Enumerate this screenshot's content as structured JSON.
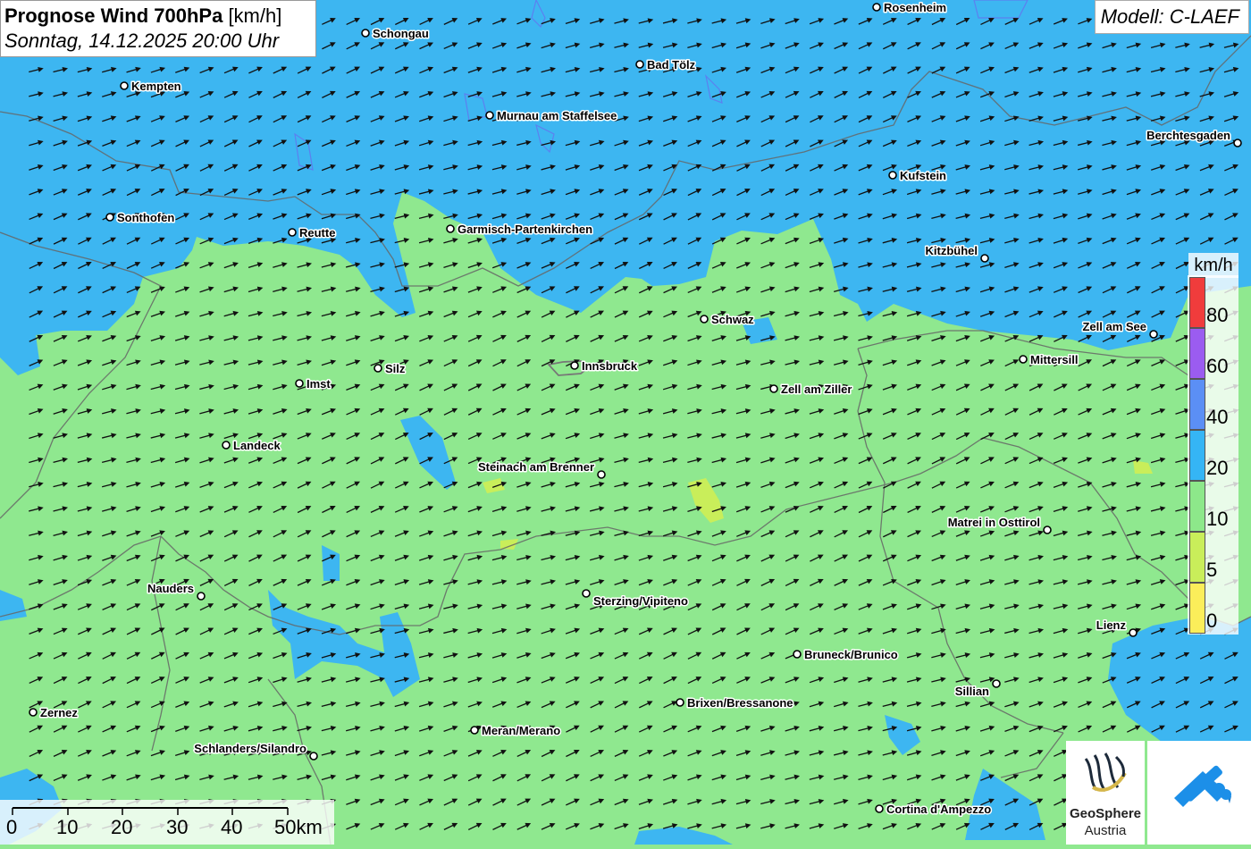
{
  "header": {
    "title_bold": "Prognose Wind 700hPa",
    "title_unit": "[km/h]",
    "subtitle": "Sonntag, 14.12.2025 20:00 Uhr"
  },
  "model": "Modell: C-LAEF",
  "legend": {
    "unit": "km/h",
    "ticks": [
      "80",
      "60",
      "40",
      "20",
      "10",
      "5",
      "0"
    ],
    "colors": [
      "#f03c3c",
      "#9b5cf0",
      "#5b8ff5",
      "#35b5f5",
      "#8de88a",
      "#c9ee5a",
      "#fbee5a"
    ]
  },
  "scale": {
    "labels": [
      "0",
      "10",
      "20",
      "30",
      "40",
      "50km"
    ]
  },
  "colors": {
    "land_green": "#8fe88f",
    "water_blue": "#3db6f1",
    "arrow": "#111111"
  },
  "cities": [
    {
      "name": "Rosenheim"
    },
    {
      "name": "Schongau"
    },
    {
      "name": "Bad Tölz"
    },
    {
      "name": "Kempten"
    },
    {
      "name": "Murnau am Staffelsee"
    },
    {
      "name": "Berchtesgaden"
    },
    {
      "name": "Kufstein"
    },
    {
      "name": "Sonthofen"
    },
    {
      "name": "Reutte"
    },
    {
      "name": "Garmisch-Partenkirchen"
    },
    {
      "name": "Kitzbühel"
    },
    {
      "name": "Schwaz"
    },
    {
      "name": "Zell am See"
    },
    {
      "name": "Mittersill"
    },
    {
      "name": "Silz"
    },
    {
      "name": "Innsbruck"
    },
    {
      "name": "Imst"
    },
    {
      "name": "Zell am Ziller"
    },
    {
      "name": "Landeck"
    },
    {
      "name": "Steinach am Brenner"
    },
    {
      "name": "Matrei in Osttirol"
    },
    {
      "name": "Nauders"
    },
    {
      "name": "Sterzing/Vipiteno"
    },
    {
      "name": "Lienz"
    },
    {
      "name": "Bruneck/Brunico"
    },
    {
      "name": "Sillian"
    },
    {
      "name": "Brixen/Bressanone"
    },
    {
      "name": "Zernez"
    },
    {
      "name": "Meran/Merano"
    },
    {
      "name": "Schlanders/Silandro"
    },
    {
      "name": "Cortina d'Ampezzo"
    }
  ],
  "logos": {
    "geosphere_name": "GeoSphere",
    "geosphere_sub": "Austria"
  }
}
